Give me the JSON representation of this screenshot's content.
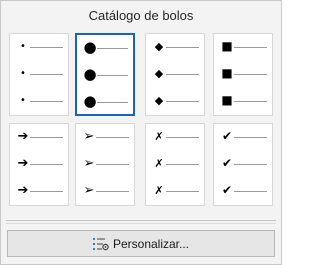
{
  "gallery": {
    "title": "Catálogo de bolos",
    "selected_index": 1,
    "styles": [
      {
        "name": "small-dot",
        "glyph": "•"
      },
      {
        "name": "filled-circle",
        "glyph": "●"
      },
      {
        "name": "diamond",
        "glyph": "◆"
      },
      {
        "name": "filled-square",
        "glyph": "■"
      },
      {
        "name": "arrow",
        "glyph": "➔"
      },
      {
        "name": "arrowhead",
        "glyph": "➢"
      },
      {
        "name": "cross",
        "glyph": "✗"
      },
      {
        "name": "check",
        "glyph": "✔"
      }
    ]
  },
  "customize": {
    "label": "Personalizar..."
  },
  "colors": {
    "selection": "#1a64b8",
    "icon_accent": "#2f7ed8"
  }
}
